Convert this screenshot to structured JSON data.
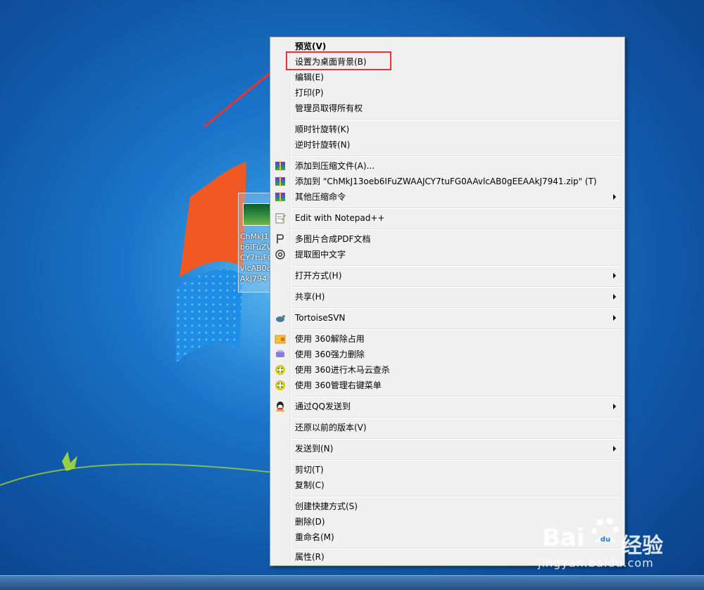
{
  "menu": {
    "items": [
      {
        "label": "预览(V)",
        "bold": true
      },
      {
        "label": "设置为桌面背景(B)"
      },
      {
        "label": "编辑(E)"
      },
      {
        "label": "打印(P)"
      },
      {
        "label": "管理员取得所有权"
      },
      {
        "label": "顺时针旋转(K)"
      },
      {
        "label": "逆时针旋转(N)"
      },
      {
        "label": "添加到压缩文件(A)...",
        "icon": "winrar-icon"
      },
      {
        "label": "添加到 \"ChMkJ13oeb6IFuZWAAJCY7tuFG0AAvlcAB0gEEAAkJ7941.zip\" (T)",
        "icon": "winrar-icon"
      },
      {
        "label": "其他压缩命令",
        "icon": "winrar-icon",
        "submenu": true
      },
      {
        "label": "Edit with Notepad++",
        "icon": "notepad-icon"
      },
      {
        "label": "多图片合成PDF文档",
        "icon": "pdf-icon"
      },
      {
        "label": "提取图中文字",
        "icon": "ocr-icon"
      },
      {
        "label": "打开方式(H)",
        "submenu": true
      },
      {
        "label": "共享(H)",
        "submenu": true
      },
      {
        "label": "TortoiseSVN",
        "icon": "tortoise-icon",
        "submenu": true
      },
      {
        "label": "使用 360解除占用",
        "icon": "unlock-360-icon"
      },
      {
        "label": "使用 360强力删除",
        "icon": "shred-360-icon"
      },
      {
        "label": "使用 360进行木马云查杀",
        "icon": "scan-360-icon"
      },
      {
        "label": "使用 360管理右键菜单",
        "icon": "menu-360-icon"
      },
      {
        "label": "通过QQ发送到",
        "icon": "qq-icon",
        "submenu": true
      },
      {
        "label": "还原以前的版本(V)"
      },
      {
        "label": "发送到(N)",
        "submenu": true
      },
      {
        "label": "剪切(T)"
      },
      {
        "label": "复制(C)"
      },
      {
        "label": "创建快捷方式(S)"
      },
      {
        "label": "删除(D)"
      },
      {
        "label": "重命名(M)"
      },
      {
        "label": "属性(R)"
      }
    ]
  },
  "desktop_icon": {
    "name_lines": [
      "ChMkJ1",
      "b6IFuZV",
      "CY7tuFC",
      "vlcAB0c",
      "AkJ794"
    ]
  },
  "watermark": {
    "brand": "Bai",
    "brand_suffix": "du",
    "product": "经验",
    "url": "jingyan.baidu.com"
  },
  "colors": {
    "highlight": "#e8342f",
    "desktop": "#1b74c9"
  }
}
